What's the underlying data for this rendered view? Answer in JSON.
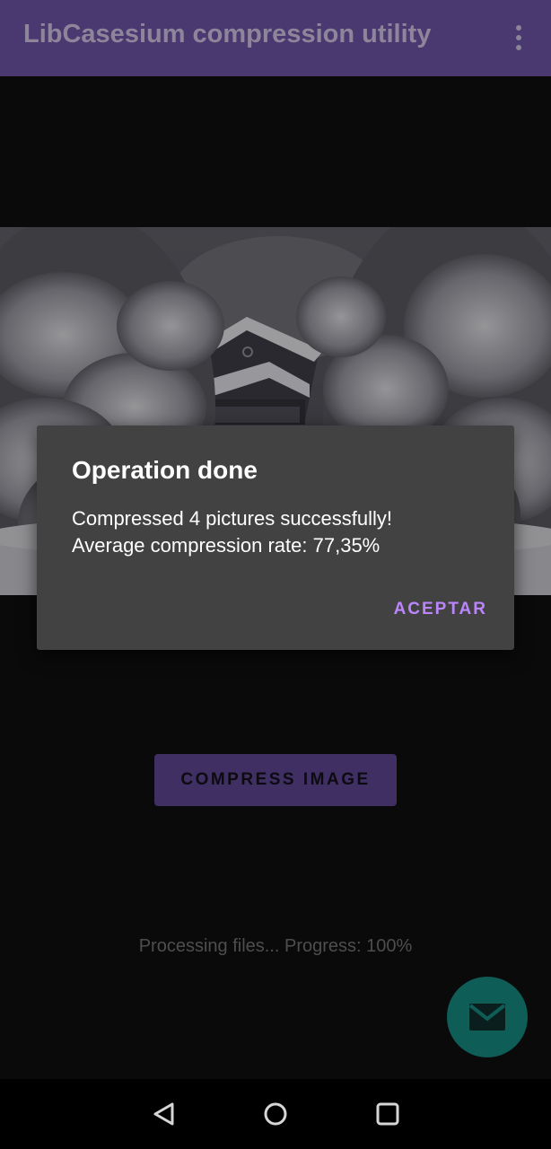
{
  "app_bar": {
    "title": "LibCasesium compression utility",
    "menu_icon": "more-vert-icon",
    "color": "#4a3870"
  },
  "main": {
    "image_description_icon": "snowy-house-photo",
    "compress_button_label": "COMPRESS IMAGE",
    "progress_text": "Processing files... Progress: 100%",
    "progress_percent": 100,
    "fab_icon": "email-icon"
  },
  "dialog": {
    "title": "Operation done",
    "message_line1": "Compressed 4 pictures successfully!",
    "message_line2": "Average compression rate: 77,35%",
    "button_label": "ACEPTAR",
    "accent": "#bb86fc"
  },
  "nav_bar": {
    "back_icon": "back-triangle-icon",
    "home_icon": "home-circle-icon",
    "recents_icon": "recents-square-icon"
  }
}
